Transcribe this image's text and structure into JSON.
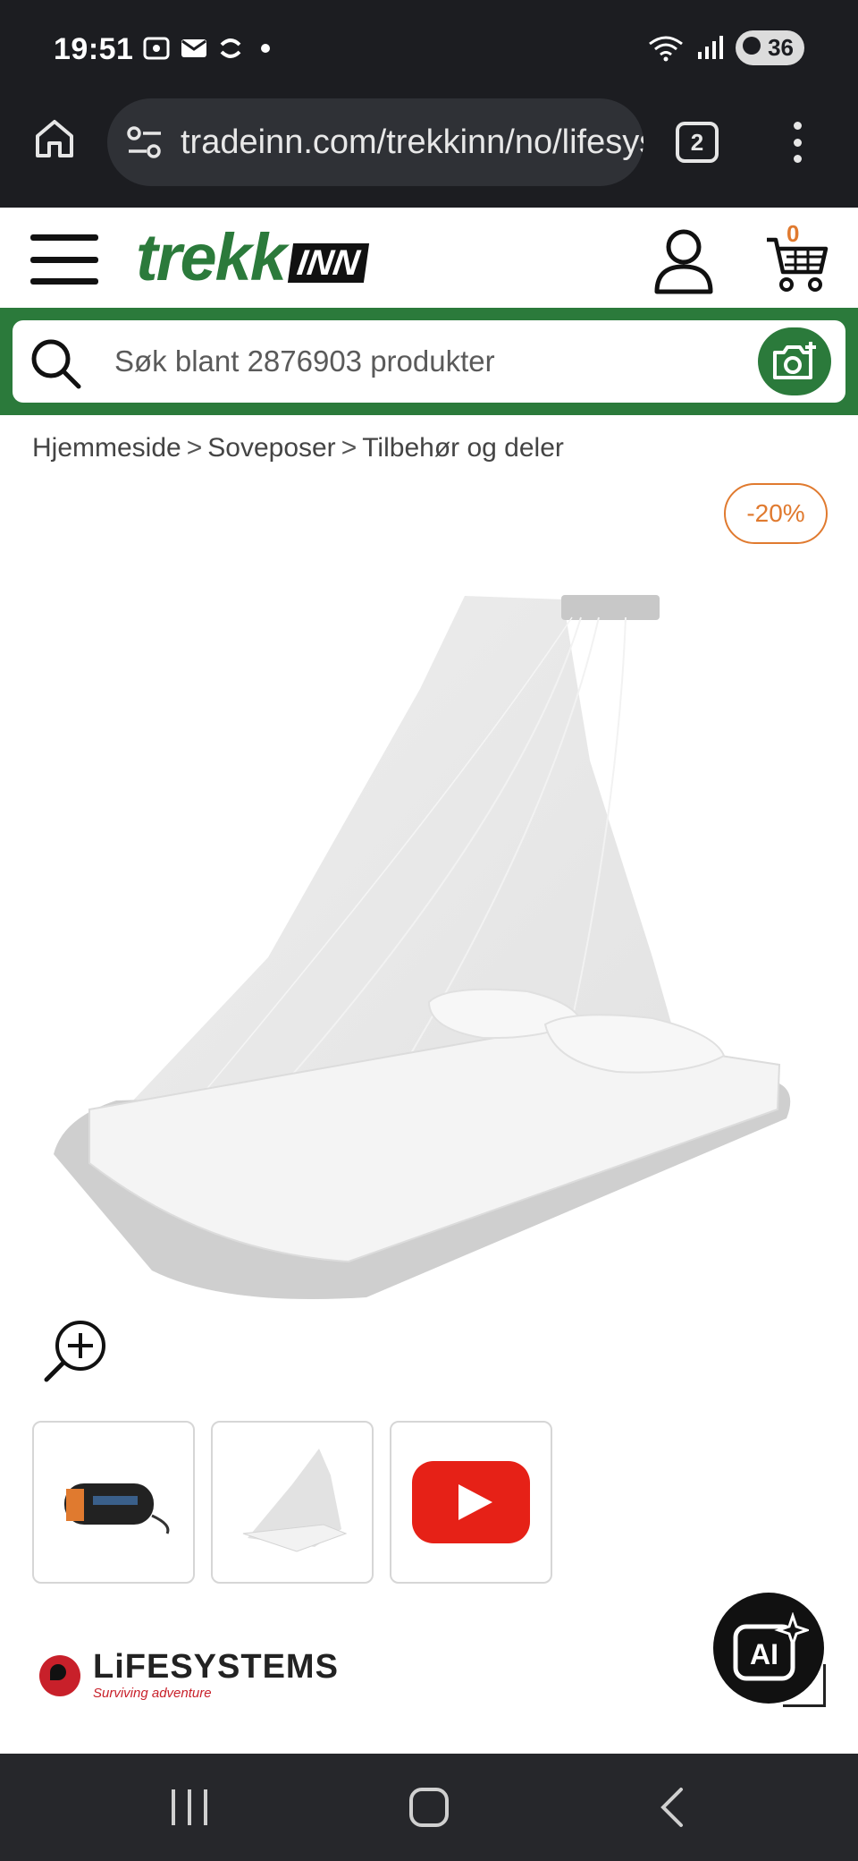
{
  "status_bar": {
    "time": "19:51",
    "battery": "36"
  },
  "browser": {
    "url": "tradeinn.com/trekkinn/no/lifesystems",
    "tab_count": "2"
  },
  "header": {
    "logo_main": "trekk",
    "logo_suffix": "INN",
    "cart_count": "0"
  },
  "search": {
    "placeholder": "Søk blant 2876903 produkter"
  },
  "breadcrumb": {
    "items": [
      "Hjemmeside",
      "Soveposer",
      "Tilbehør og deler"
    ]
  },
  "product": {
    "discount": "-20%"
  },
  "brand": {
    "name": "LiFESYSTEMS",
    "tagline": "Surviving adventure"
  },
  "ai_button": {
    "label": "AI"
  },
  "colors": {
    "brand_green": "#2b7a3b",
    "discount_orange": "#e07a2f",
    "youtube_red": "#e62117"
  }
}
